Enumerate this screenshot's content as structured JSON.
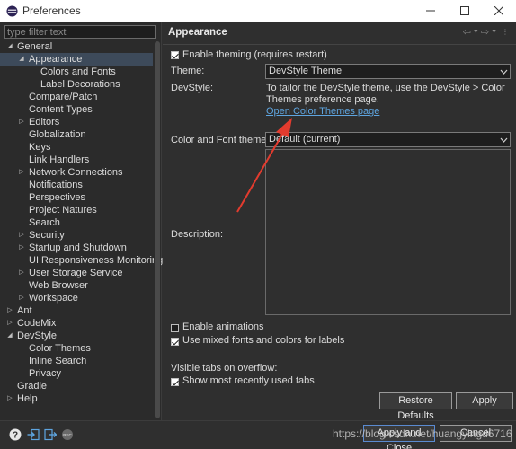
{
  "window": {
    "title": "Preferences"
  },
  "filter": {
    "placeholder": "type filter text"
  },
  "tree": [
    {
      "label": "General",
      "indent": 0,
      "arrow": "open"
    },
    {
      "label": "Appearance",
      "indent": 1,
      "arrow": "open",
      "selected": true
    },
    {
      "label": "Colors and Fonts",
      "indent": 2,
      "arrow": ""
    },
    {
      "label": "Label Decorations",
      "indent": 2,
      "arrow": ""
    },
    {
      "label": "Compare/Patch",
      "indent": 1,
      "arrow": ""
    },
    {
      "label": "Content Types",
      "indent": 1,
      "arrow": ""
    },
    {
      "label": "Editors",
      "indent": 1,
      "arrow": "closed"
    },
    {
      "label": "Globalization",
      "indent": 1,
      "arrow": ""
    },
    {
      "label": "Keys",
      "indent": 1,
      "arrow": ""
    },
    {
      "label": "Link Handlers",
      "indent": 1,
      "arrow": ""
    },
    {
      "label": "Network Connections",
      "indent": 1,
      "arrow": "closed"
    },
    {
      "label": "Notifications",
      "indent": 1,
      "arrow": ""
    },
    {
      "label": "Perspectives",
      "indent": 1,
      "arrow": ""
    },
    {
      "label": "Project Natures",
      "indent": 1,
      "arrow": ""
    },
    {
      "label": "Search",
      "indent": 1,
      "arrow": ""
    },
    {
      "label": "Security",
      "indent": 1,
      "arrow": "closed"
    },
    {
      "label": "Startup and Shutdown",
      "indent": 1,
      "arrow": "closed"
    },
    {
      "label": "UI Responsiveness Monitoring",
      "indent": 1,
      "arrow": ""
    },
    {
      "label": "User Storage Service",
      "indent": 1,
      "arrow": "closed"
    },
    {
      "label": "Web Browser",
      "indent": 1,
      "arrow": ""
    },
    {
      "label": "Workspace",
      "indent": 1,
      "arrow": "closed"
    },
    {
      "label": "Ant",
      "indent": 0,
      "arrow": "closed"
    },
    {
      "label": "CodeMix",
      "indent": 0,
      "arrow": "closed"
    },
    {
      "label": "DevStyle",
      "indent": 0,
      "arrow": "open"
    },
    {
      "label": "Color Themes",
      "indent": 1,
      "arrow": ""
    },
    {
      "label": "Inline Search",
      "indent": 1,
      "arrow": ""
    },
    {
      "label": "Privacy",
      "indent": 1,
      "arrow": ""
    },
    {
      "label": "Gradle",
      "indent": 0,
      "arrow": ""
    },
    {
      "label": "Help",
      "indent": 0,
      "arrow": "closed"
    }
  ],
  "page": {
    "title": "Appearance",
    "enable_theming_label": "Enable theming (requires restart)",
    "theme_label": "Theme:",
    "theme_value": "DevStyle Theme",
    "devstyle_label": "DevStyle:",
    "devstyle_text_1": "To tailor the DevStyle theme, use the DevStyle > Color",
    "devstyle_text_2": "Themes preference page.",
    "devstyle_link": "Open Color Themes page",
    "color_font_label": "Color and Font theme:",
    "color_font_value": "Default (current)",
    "description_label": "Description:",
    "enable_animations_label": "Enable animations",
    "mixed_fonts_label": "Use mixed fonts and colors for labels",
    "visible_tabs_label": "Visible tabs on overflow:",
    "show_recent_tabs_label": "Show most recently used tabs",
    "restore_defaults": "Restore Defaults",
    "apply": "Apply"
  },
  "bottom": {
    "apply_and_close": "Apply and Close",
    "cancel": "Cancel"
  },
  "watermark": "https://blog.csdn.net/huangyingd6716",
  "colors": {
    "accent": "#5ea5e0",
    "annotation_arrow": "#e23b2e"
  }
}
